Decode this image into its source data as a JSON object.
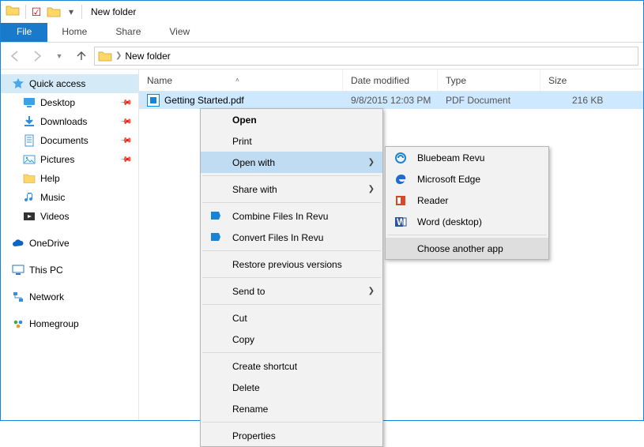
{
  "title": "New folder",
  "ribbon": {
    "file": "File",
    "home": "Home",
    "share": "Share",
    "view": "View"
  },
  "breadcrumb": "New folder",
  "columns": {
    "name": "Name",
    "date": "Date modified",
    "type": "Type",
    "size": "Size"
  },
  "row": {
    "name": "Getting Started.pdf",
    "date": "9/8/2015 12:03 PM",
    "type": "PDF Document",
    "size": "216 KB"
  },
  "sidebar": {
    "quick": "Quick access",
    "desktop": "Desktop",
    "downloads": "Downloads",
    "documents": "Documents",
    "pictures": "Pictures",
    "help": "Help",
    "music": "Music",
    "videos": "Videos",
    "onedrive": "OneDrive",
    "thispc": "This PC",
    "network": "Network",
    "homegroup": "Homegroup"
  },
  "ctx1": {
    "open": "Open",
    "print": "Print",
    "openwith": "Open with",
    "sharewith": "Share with",
    "combine": "Combine Files In Revu",
    "convert": "Convert Files In Revu",
    "restore": "Restore previous versions",
    "sendto": "Send to",
    "cut": "Cut",
    "copy": "Copy",
    "shortcut": "Create shortcut",
    "delete": "Delete",
    "rename": "Rename",
    "properties": "Properties"
  },
  "ctx2": {
    "bluebeam": "Bluebeam Revu",
    "edge": "Microsoft Edge",
    "reader": "Reader",
    "word": "Word (desktop)",
    "choose": "Choose another app"
  }
}
